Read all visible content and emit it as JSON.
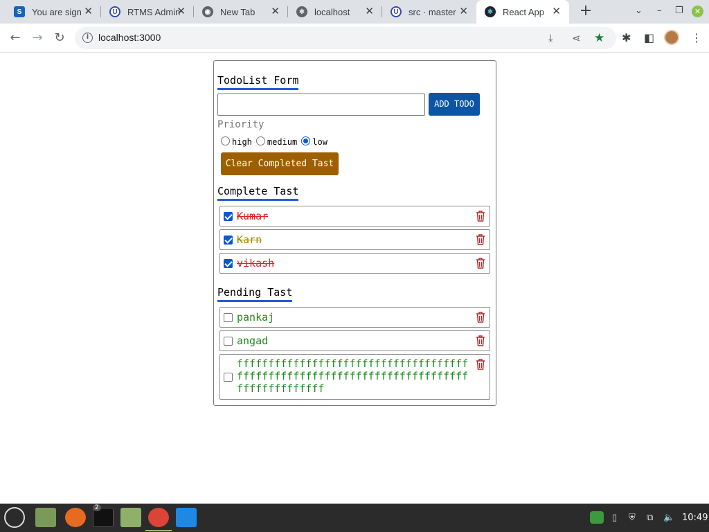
{
  "browser": {
    "tabs": [
      {
        "title": "You are sign",
        "icon": "s-icon"
      },
      {
        "title": "RTMS Admin",
        "icon": "u-icon"
      },
      {
        "title": "New Tab",
        "icon": "chrome-icon"
      },
      {
        "title": "localhost",
        "icon": "react-icon"
      },
      {
        "title": "src · master",
        "icon": "u-icon"
      },
      {
        "title": "React App",
        "icon": "react-icon"
      }
    ],
    "url": "localhost:3000"
  },
  "form": {
    "title": "TodoList Form",
    "input_value": "",
    "add_label": "ADD TODO",
    "priority_label": "Priority",
    "priorities": [
      {
        "label": "high",
        "checked": false
      },
      {
        "label": "medium",
        "checked": false
      },
      {
        "label": "low",
        "checked": true
      }
    ],
    "clear_label": "Clear Completed Tast"
  },
  "complete": {
    "title": "Complete Tast",
    "items": [
      {
        "text": "Kumar",
        "checked": true,
        "color": "#e02020"
      },
      {
        "text": "Karn",
        "checked": true,
        "color": "#a08a00"
      },
      {
        "text": "vikash",
        "checked": true,
        "color": "#e02020"
      }
    ]
  },
  "pending": {
    "title": "Pending Tast",
    "items": [
      {
        "text": "pankaj",
        "checked": false,
        "color": "#1a8a1a"
      },
      {
        "text": "angad",
        "checked": false,
        "color": "#1a8a1a"
      },
      {
        "text": "ffffffffffffffffffffffffffffffffffffffffffffffffffffffffffffffffffffffffffffffffffffffff",
        "checked": false,
        "color": "#1a8a1a"
      }
    ]
  },
  "taskbar": {
    "terminal_badge": "2",
    "clock": "10:49"
  },
  "colors": {
    "accent_underline": "#2a5bd7",
    "add_button": "#0c55a5",
    "clear_button": "#9e5f00",
    "trash_icon": "#b22a2a"
  }
}
